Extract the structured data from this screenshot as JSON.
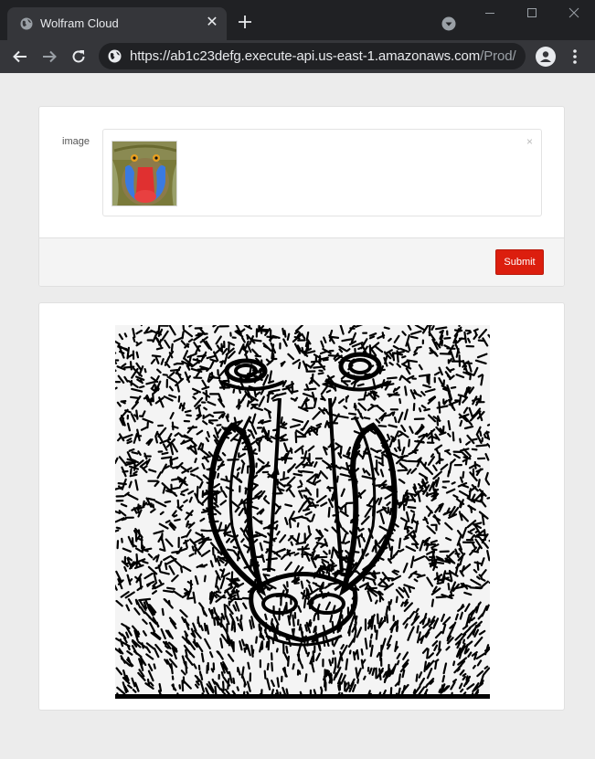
{
  "browser": {
    "tab_title": "Wolfram Cloud",
    "url_main": "https://ab1c23defg.execute-api.us-east-1.amazonaws.com",
    "url_path": "/Prod/"
  },
  "form": {
    "field_label": "image",
    "clear_symbol": "×",
    "submit_label": "Submit"
  },
  "result": {
    "image_desc_icon": "mandrill-edge-detection-image"
  },
  "colors": {
    "chrome_dark": "#202124",
    "chrome_tab": "#35363a",
    "page_bg": "#ececec",
    "submit_red": "#dc1e0e"
  }
}
